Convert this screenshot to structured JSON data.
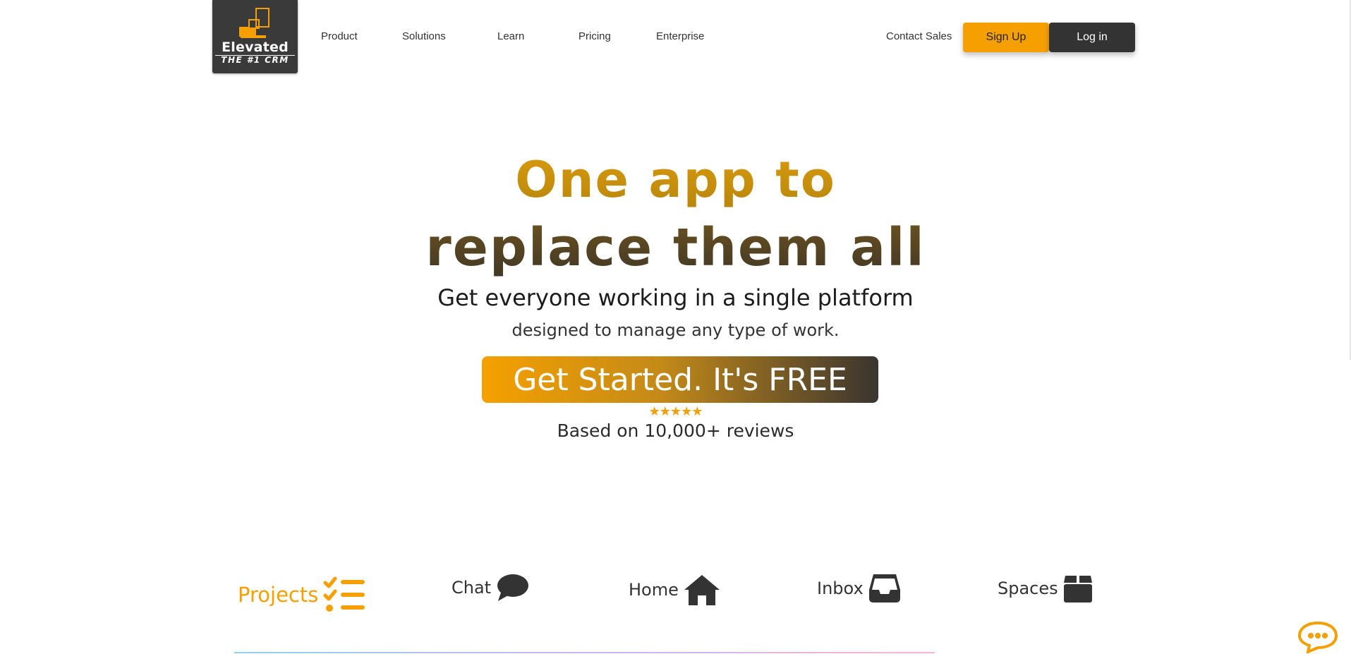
{
  "logo": {
    "brand": "Elevated",
    "tagline": "THE #1 CRM"
  },
  "nav": {
    "product": "Product",
    "solutions": "Solutions",
    "learn": "Learn",
    "pricing": "Pricing",
    "enterprise": "Enterprise",
    "contact_sales": "Contact Sales",
    "sign_up": "Sign Up",
    "log_in": "Log in"
  },
  "hero": {
    "title_line1": "One app to",
    "title_line2": "replace them all",
    "subtitle_line1": "Get everyone working in a single platform",
    "subtitle_line2": "designed to manage any type of work.",
    "cta": "Get Started. It's FREE",
    "rating_stars": "★★★★★",
    "reviews": "Based on 10,000+ reviews"
  },
  "tabs": [
    {
      "label": "Projects",
      "icon": "checklist-icon",
      "active": true
    },
    {
      "label": "Chat",
      "icon": "chat-bubble-icon",
      "active": false
    },
    {
      "label": "Home",
      "icon": "home-icon",
      "active": false
    },
    {
      "label": "Inbox",
      "icon": "inbox-icon",
      "active": false
    },
    {
      "label": "Spaces",
      "icon": "box-icon",
      "active": false
    }
  ],
  "colors": {
    "accent": "#f5a000",
    "dark": "#333333",
    "title_gold": "#d99a0f",
    "title_brown": "#4a3b22"
  }
}
